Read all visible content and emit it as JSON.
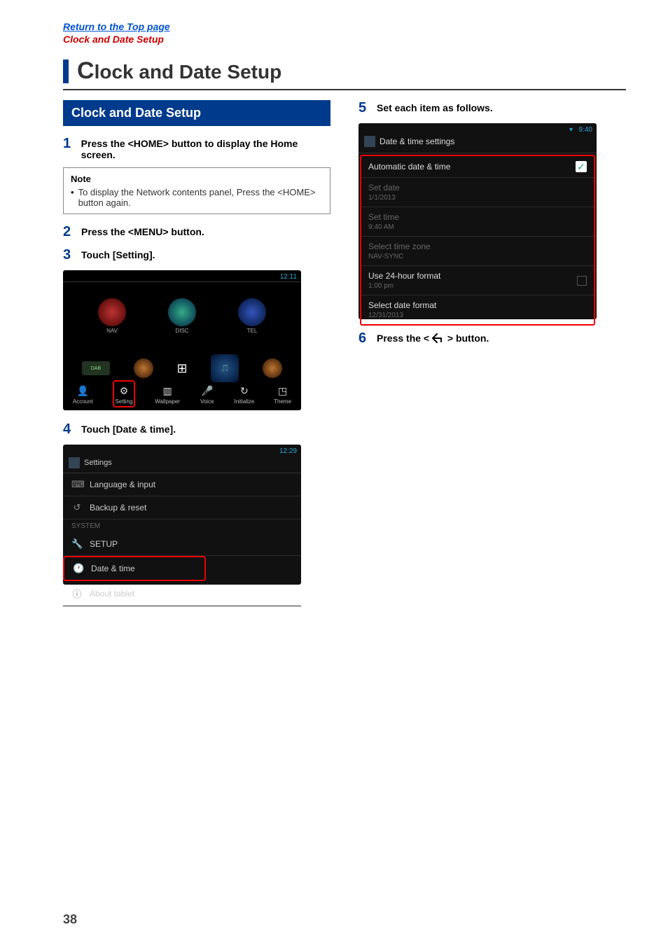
{
  "nav": {
    "top_link": "Return to the Top page",
    "breadcrumb": "Clock and Date Setup"
  },
  "heading": {
    "title_suffix": "lock and Date Setup"
  },
  "left": {
    "section_title": "Clock and Date Setup",
    "step1": {
      "num": "1",
      "text": "Press the <HOME> button to display the Home screen."
    },
    "note_title": "Note",
    "note_text": "To display the Network contents panel, Press the <HOME> button again.",
    "step2": {
      "num": "2",
      "text": "Press the <MENU> button."
    },
    "step3": {
      "num": "3",
      "text": "Touch [Setting]."
    },
    "ss1": {
      "time": "12:11",
      "nav": "NAV",
      "disc": "DISC",
      "tel": "TEL",
      "dab": "DAB",
      "btm": [
        "Account",
        "Setting",
        "Wallpaper",
        "Voice",
        "Initialize",
        "Theme"
      ]
    },
    "step4": {
      "num": "4",
      "text": "Touch [Date & time]."
    },
    "ss2": {
      "time": "12:29",
      "header": "Settings",
      "rows": {
        "lang": "Language & input",
        "backup": "Backup & reset",
        "system": "SYSTEM",
        "setup": "SETUP",
        "datetime": "Date & time",
        "about": "About tablet"
      }
    }
  },
  "right": {
    "step5": {
      "num": "5",
      "text": "Set each item as follows."
    },
    "ss3": {
      "time": "9:40",
      "header": "Date & time settings",
      "rows": {
        "auto": "Automatic date & time",
        "setdate": {
          "label": "Set date",
          "sub": "1/1/2013"
        },
        "settime": {
          "label": "Set time",
          "sub": "9:40 AM"
        },
        "tz": {
          "label": "Select time zone",
          "sub": "NAV-SYNC"
        },
        "h24": {
          "label": "Use 24-hour format",
          "sub": "1:00 pm"
        },
        "datefmt": {
          "label": "Select date format",
          "sub": "12/31/2013"
        }
      }
    },
    "step6_prefix": "Press the < ",
    "step6_suffix": " > button.",
    "step6_num": "6"
  },
  "page_number": "38"
}
